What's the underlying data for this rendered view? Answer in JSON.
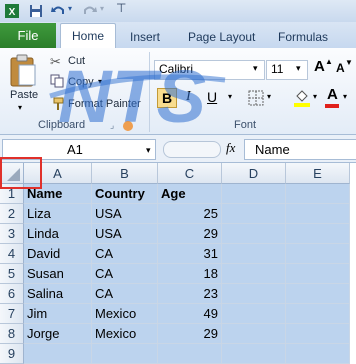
{
  "quick_access": {
    "save_icon": "save-icon",
    "undo_icon": "undo-icon",
    "redo_icon": "redo-icon",
    "customize_icon": "customize-qat-icon"
  },
  "tabs": {
    "file": "File",
    "items": [
      "Home",
      "Insert",
      "Page Layout",
      "Formulas"
    ],
    "active": "Home"
  },
  "clipboard": {
    "paste": "Paste",
    "cut": "Cut",
    "copy": "Copy",
    "copy_arrow": "▾",
    "format_painter": "Format Painter",
    "group_label": "Clipboard"
  },
  "font": {
    "family": "Calibri",
    "size": "11",
    "grow": "A",
    "shrink": "A",
    "bold": "B",
    "italic": "I",
    "underline": "U",
    "font_color_letter": "A",
    "group_label": "Font",
    "font_color": "#e0201b",
    "highlight_color": "#ffff00"
  },
  "watermark": {
    "text": "NTS",
    "color": "#2f6fd0"
  },
  "formula_bar": {
    "name_box": "A1",
    "fx": "fx",
    "formula": "Name"
  },
  "columns": [
    "A",
    "B",
    "C",
    "D",
    "E"
  ],
  "rows": [
    "1",
    "2",
    "3",
    "4",
    "5",
    "6",
    "7",
    "8",
    "9"
  ],
  "table": {
    "header": [
      "Name",
      "Country",
      "Age"
    ],
    "data": [
      [
        "Liza",
        "USA",
        "25"
      ],
      [
        "Linda",
        "USA",
        "29"
      ],
      [
        "David",
        "CA",
        "31"
      ],
      [
        "Susan",
        "CA",
        "18"
      ],
      [
        "Salina",
        "CA",
        "23"
      ],
      [
        "Jim",
        "Mexico",
        "49"
      ],
      [
        "Jorge",
        "Mexico",
        "29"
      ]
    ]
  },
  "selection_color": "#bcd3ee",
  "highlight_box_color": "#e0302a"
}
